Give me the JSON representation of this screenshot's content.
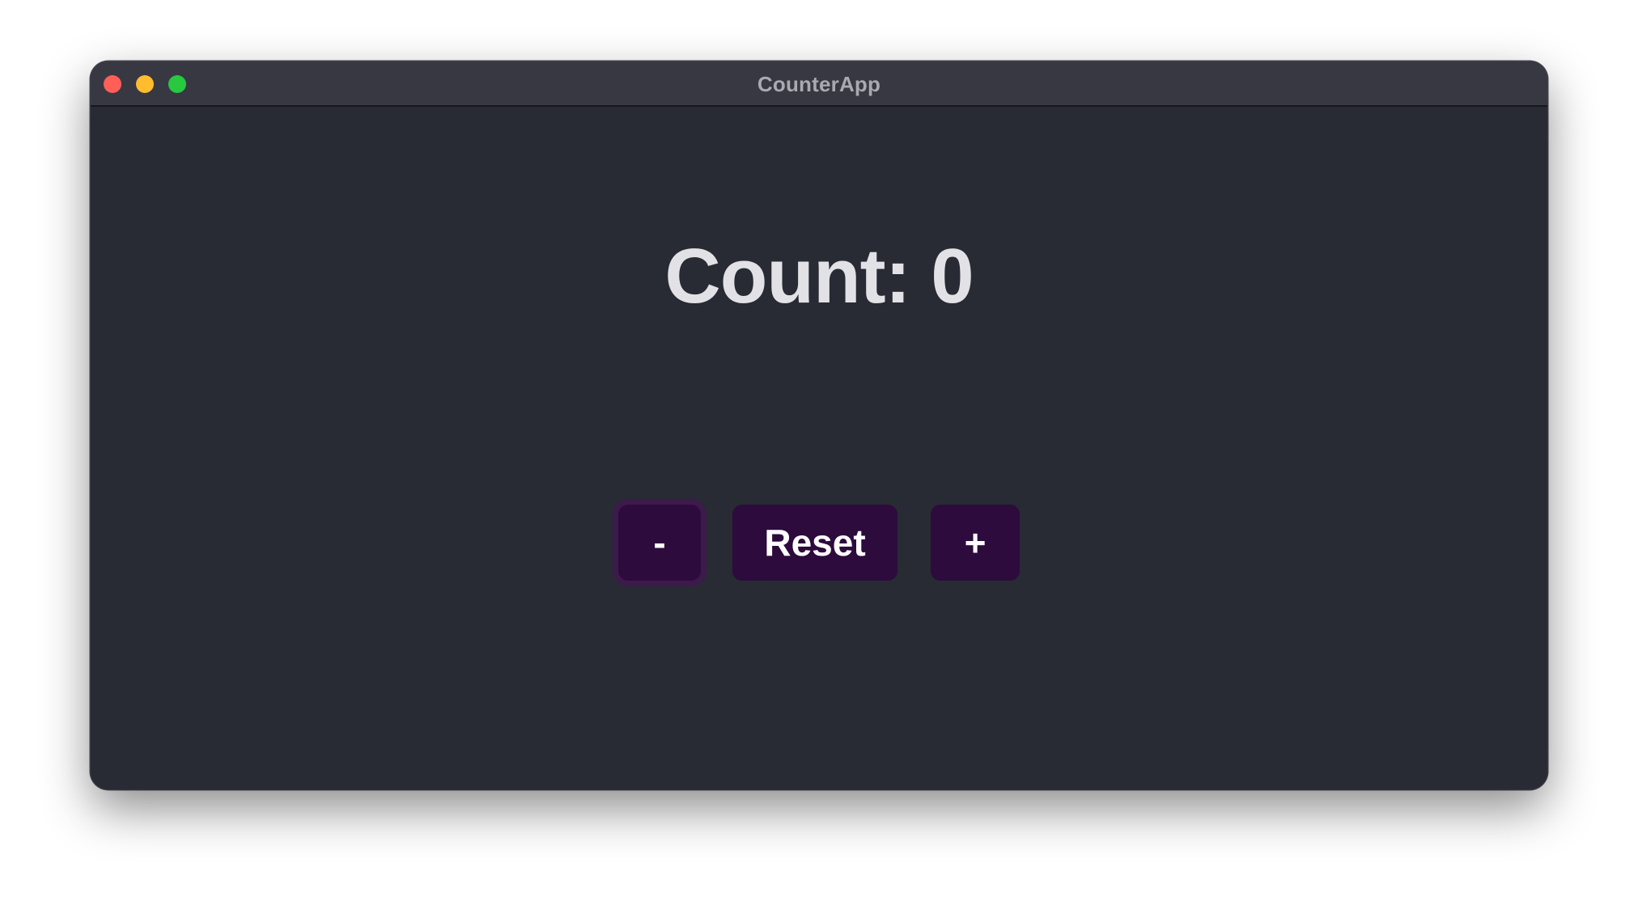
{
  "window": {
    "title": "CounterApp",
    "traffic_lights": {
      "close_color": "#ff5f57",
      "minimize_color": "#febc2e",
      "zoom_color": "#28c840"
    }
  },
  "counter": {
    "label": "Count: 0",
    "value": 0
  },
  "buttons": {
    "decrement_label": "-",
    "reset_label": "Reset",
    "increment_label": "+",
    "focused": "decrement"
  },
  "colors": {
    "background": "#282a34",
    "titlebar": "#383842",
    "button": "#2d0b3d",
    "focus_ring": "#3c1b4c",
    "count_text": "#e2e2e6",
    "title_text": "#a9a9b1"
  }
}
